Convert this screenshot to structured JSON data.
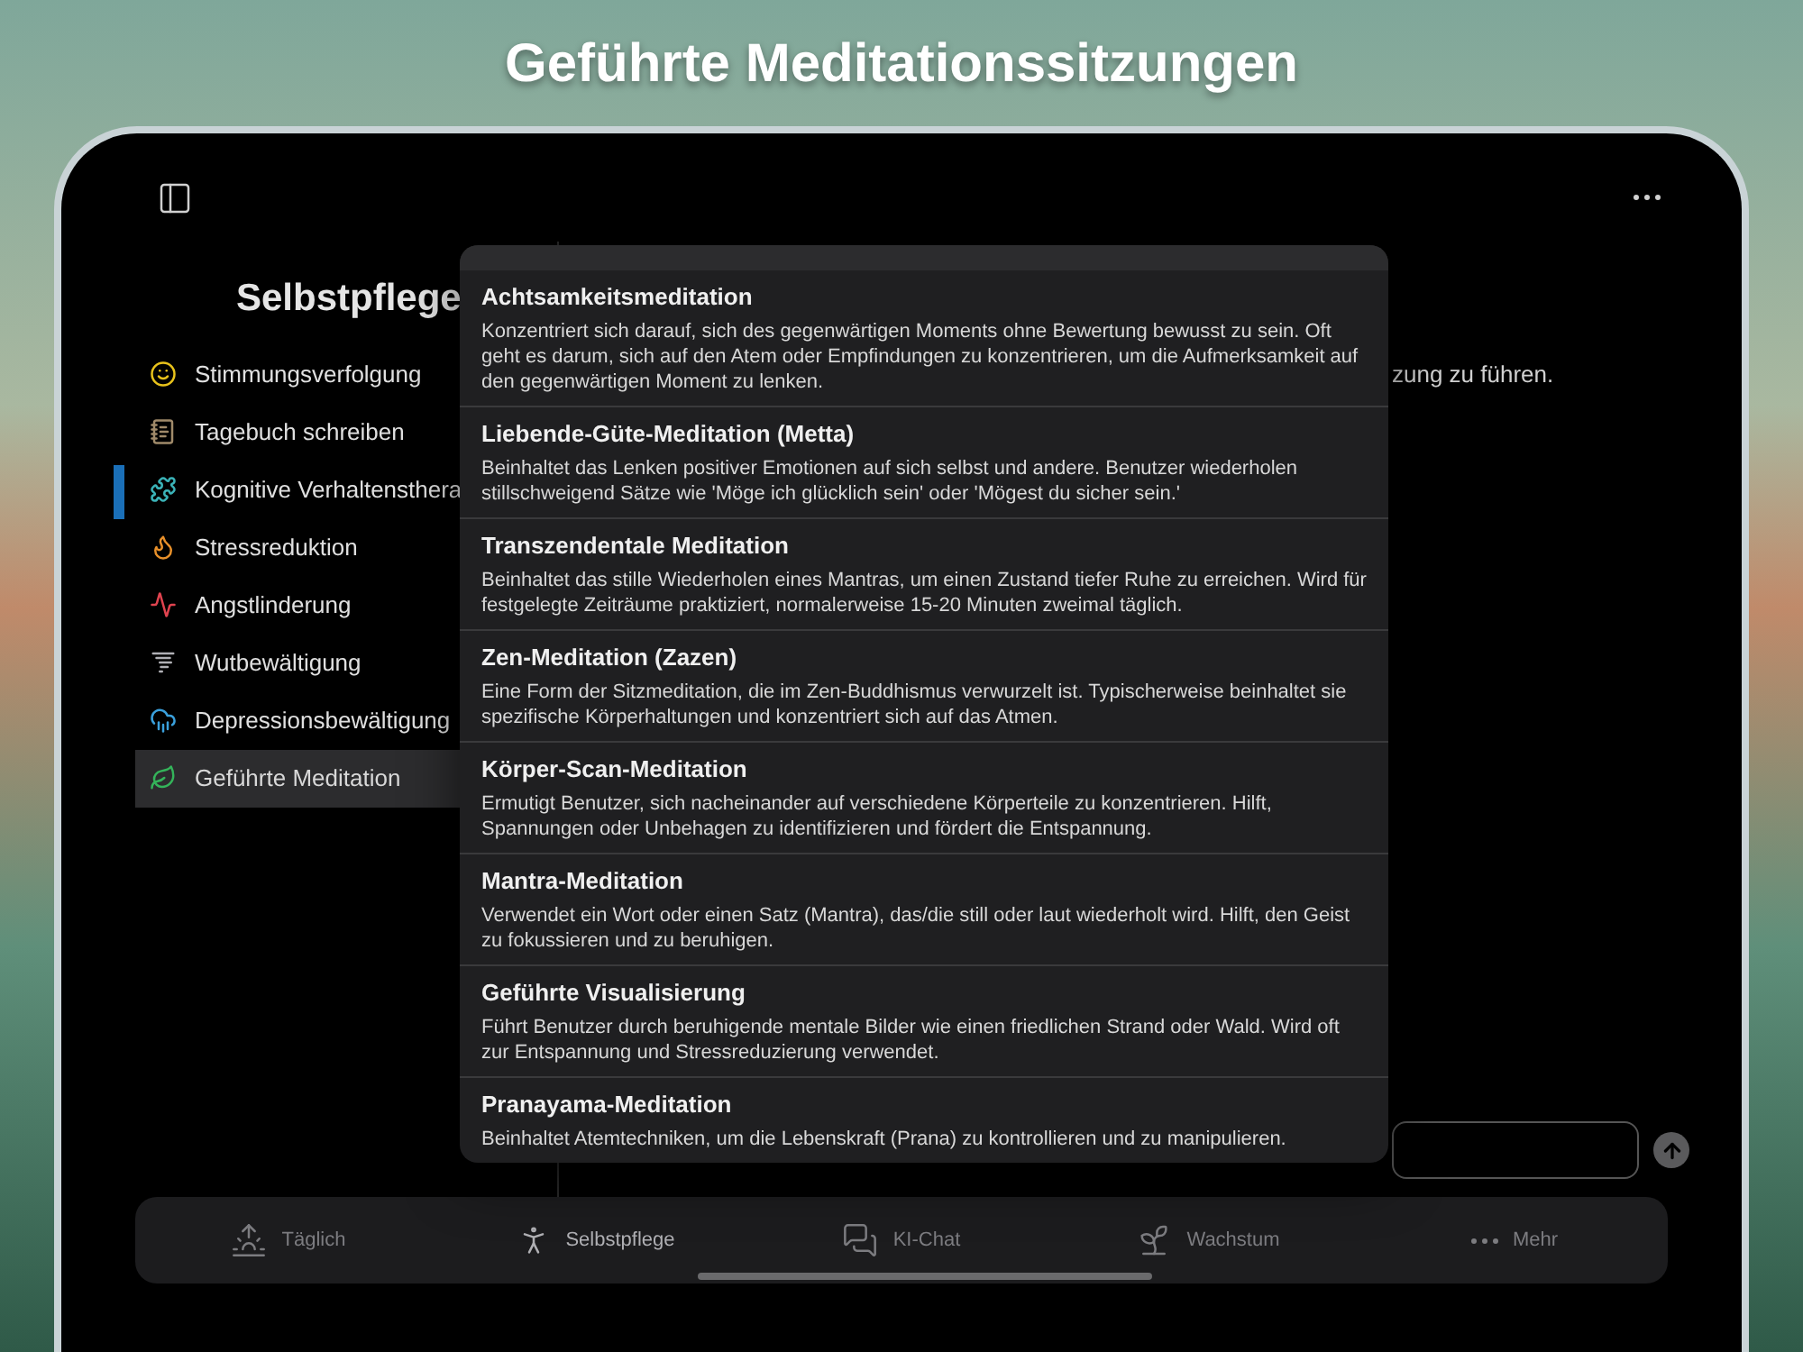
{
  "headline": "Geführte Meditationssitzungen",
  "sidebar": {
    "title": "Selbstpflege",
    "items": [
      {
        "label": "Stimmungsverfolgung",
        "selected": false,
        "focused": false
      },
      {
        "label": "Tagebuch schreiben",
        "selected": false,
        "focused": false
      },
      {
        "label": "Kognitive Verhaltensthera",
        "selected": false,
        "focused": true
      },
      {
        "label": "Stressreduktion",
        "selected": false,
        "focused": false
      },
      {
        "label": "Angstlinderung",
        "selected": false,
        "focused": false
      },
      {
        "label": "Wutbewältigung",
        "selected": false,
        "focused": false
      },
      {
        "label": "Depressionsbewältigung",
        "selected": false,
        "focused": false
      },
      {
        "label": "Geführte Meditation",
        "selected": true,
        "focused": false
      }
    ]
  },
  "main": {
    "text": "zung zu führen."
  },
  "popover": {
    "items": [
      {
        "title": "Achtsamkeitsmeditation",
        "description": "Konzentriert sich darauf, sich des gegenwärtigen Moments ohne Bewertung bewusst zu sein. Oft geht es darum, sich auf den Atem oder Empfindungen zu konzentrieren, um die Aufmerksamkeit auf den gegenwärtigen Moment zu lenken."
      },
      {
        "title": "Liebende-Güte-Meditation (Metta)",
        "description": "Beinhaltet das Lenken positiver Emotionen auf sich selbst und andere. Benutzer wiederholen stillschweigend Sätze wie 'Möge ich glücklich sein' oder 'Mögest du sicher sein.'"
      },
      {
        "title": "Transzendentale Meditation",
        "description": "Beinhaltet das stille Wiederholen eines Mantras, um einen Zustand tiefer Ruhe zu erreichen. Wird für festgelegte Zeiträume praktiziert, normalerweise 15-20 Minuten zweimal täglich."
      },
      {
        "title": "Zen-Meditation (Zazen)",
        "description": "Eine Form der Sitzmeditation, die im Zen-Buddhismus verwurzelt ist. Typischerweise beinhaltet sie spezifische Körperhaltungen und konzentriert sich auf das Atmen."
      },
      {
        "title": "Körper-Scan-Meditation",
        "description": "Ermutigt Benutzer, sich nacheinander auf verschiedene Körperteile zu konzentrieren. Hilft, Spannungen oder Unbehagen zu identifizieren und fördert die Entspannung."
      },
      {
        "title": "Mantra-Meditation",
        "description": "Verwendet ein Wort oder einen Satz (Mantra), das/die still oder laut wiederholt wird. Hilft, den Geist zu fokussieren und zu beruhigen."
      },
      {
        "title": "Geführte Visualisierung",
        "description": "Führt Benutzer durch beruhigende mentale Bilder wie einen friedlichen Strand oder Wald. Wird oft zur Entspannung und Stressreduzierung verwendet."
      },
      {
        "title": "Pranayama-Meditation",
        "description": "Beinhaltet Atemtechniken, um die Lebenskraft (Prana) zu kontrollieren und zu manipulieren."
      }
    ]
  },
  "tab_bar": [
    {
      "label": "Täglich",
      "selected": false
    },
    {
      "label": "Selbstpflege",
      "selected": true
    },
    {
      "label": "KI-Chat",
      "selected": false
    },
    {
      "label": "Wachstum",
      "selected": false
    },
    {
      "label": "Mehr",
      "selected": false
    }
  ]
}
